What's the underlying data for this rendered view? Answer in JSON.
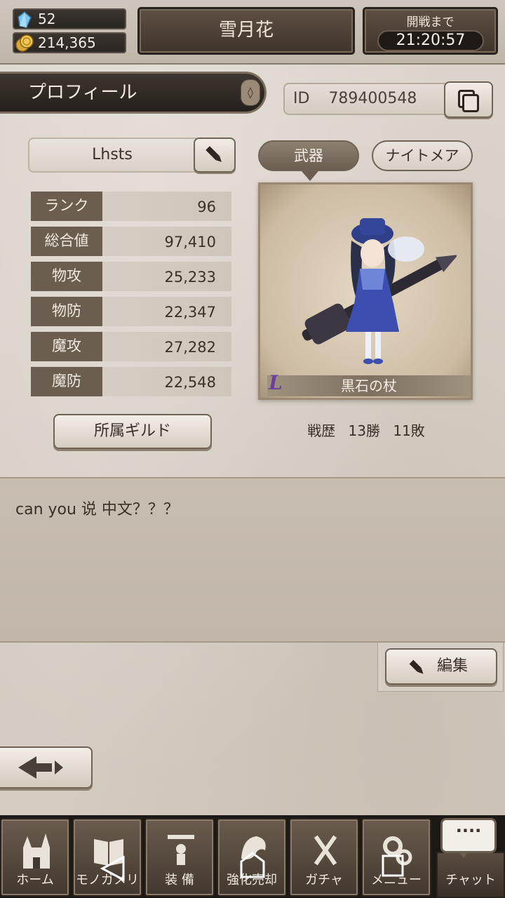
{
  "resources": {
    "crystals": "52",
    "gold": "214,365"
  },
  "header": {
    "title": "雪月花",
    "timer_label": "開戦まで",
    "timer_value": "21:20:57"
  },
  "profile": {
    "tab_label": "プロフィール",
    "id_label": "ID",
    "id_value": "789400548",
    "name": "Lhsts",
    "stats": [
      {
        "label": "ランク",
        "value": "96"
      },
      {
        "label": "総合値",
        "value": "97,410"
      },
      {
        "label": "物攻",
        "value": "25,233"
      },
      {
        "label": "物防",
        "value": "22,347"
      },
      {
        "label": "魔攻",
        "value": "27,282"
      },
      {
        "label": "魔防",
        "value": "22,548"
      }
    ],
    "guild_button": "所属ギルド"
  },
  "card_tabs": {
    "weapon": "武器",
    "nightmare": "ナイトメア"
  },
  "card": {
    "rank_letter": "L",
    "weapon_name": "黒石の杖"
  },
  "record": {
    "label": "戦歴",
    "wins": "13勝",
    "losses": "11敗"
  },
  "comment": {
    "text": "can you 说 中文？？？",
    "edit_label": "編集"
  },
  "nav": {
    "home": "ホーム",
    "camera": "モノガメリ",
    "equip": "装 備",
    "enhance": "強化売却",
    "gacha": "ガチャ",
    "menu": "メニュー",
    "chat": "チャット",
    "chat_bubble": "····"
  },
  "colors": {
    "accent_dark": "#3e3630",
    "panel": "#6b5e51",
    "parchment": "#d9d1c8",
    "rank_purple": "#6a3fa0"
  }
}
